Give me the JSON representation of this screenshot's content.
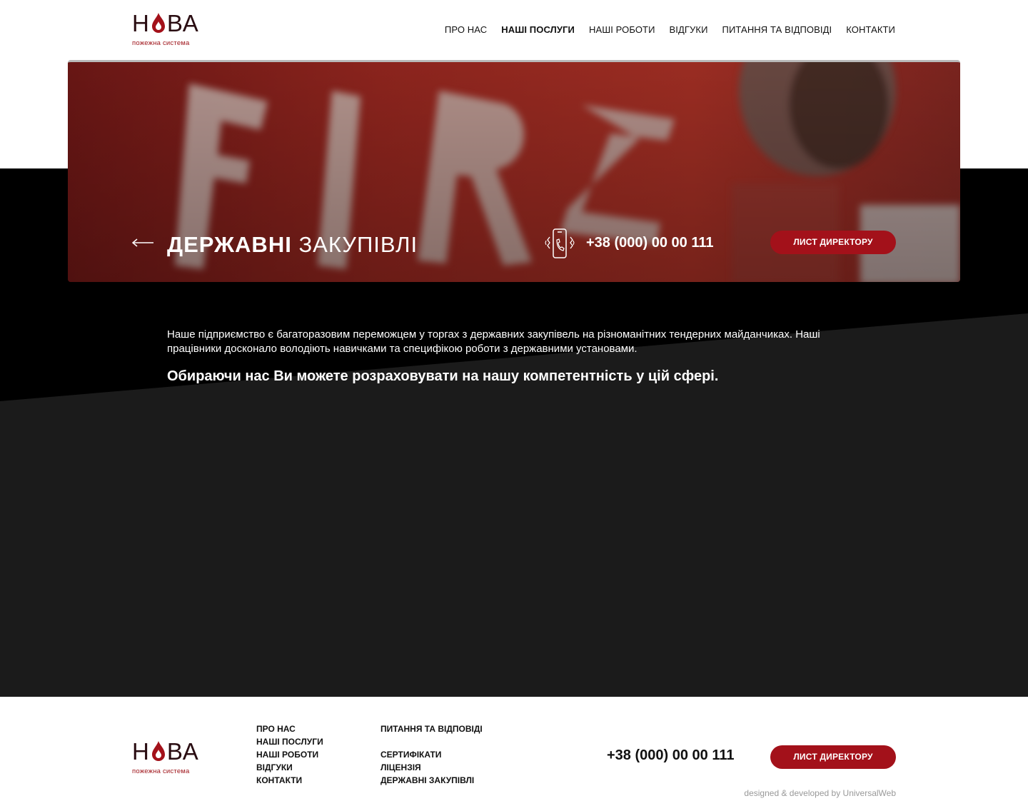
{
  "header": {
    "logo": {
      "word_left": "Н",
      "word_right": "ВА",
      "subtitle": "пожежна система"
    },
    "nav": [
      {
        "label": "ПРО НАС"
      },
      {
        "label": "НАШІ ПОСЛУГИ"
      },
      {
        "label": "НАШІ РОБОТИ"
      },
      {
        "label": "ВІДГУКИ"
      },
      {
        "label": "ПИТАННЯ ТА ВІДПОВІДІ"
      },
      {
        "label": "КОНТАКТИ"
      }
    ],
    "active_nav": "НАШІ ПОСЛУГИ"
  },
  "hero": {
    "title_bold": "ДЕРЖАВНІ",
    "title_light": "ЗАКУПІВЛІ",
    "phone": "+38 (000) 00 00 111",
    "button_label": "ЛИСТ ДИРЕКТОРУ"
  },
  "content": {
    "paragraph": "Наше підприємство є багаторазовим переможцем у торгах з  державних закупівель на різноманітних тендерних майданчиках. Наші працівники досконало володіють навичками та специфікою роботи з державними установами.",
    "highlight": "Обираючи нас Ви можете розраховувати на нашу компетентність у цій сфері."
  },
  "footer": {
    "logo": {
      "word_left": "Н",
      "word_right": "ВА",
      "subtitle": "пожежна система"
    },
    "col1": [
      "ПРО НАС",
      "НАШІ ПОСЛУГИ",
      "НАШІ РОБОТИ",
      "ВІДГУКИ",
      "КОНТАКТИ"
    ],
    "col2_top": "ПИТАННЯ ТА ВІДПОВІДІ",
    "col2": [
      "СЕРТИФІКАТИ",
      "ЛІЦЕНЗІЯ",
      "ДЕРЖАВНІ ЗАКУПІВЛІ"
    ],
    "phone": "+38 (000) 00 00 111",
    "button_label": "ЛИСТ ДИРЕКТОРУ",
    "credit": "designed & developed by UniversalWeb"
  },
  "colors": {
    "accent": "#a3111a",
    "dark_band": "#000000",
    "dark_panel": "#1b1b1b"
  },
  "icons": {
    "back": "arrow-left-icon",
    "phone": "vibrating-phone-icon",
    "logo_drop": "flame-drop-icon"
  }
}
